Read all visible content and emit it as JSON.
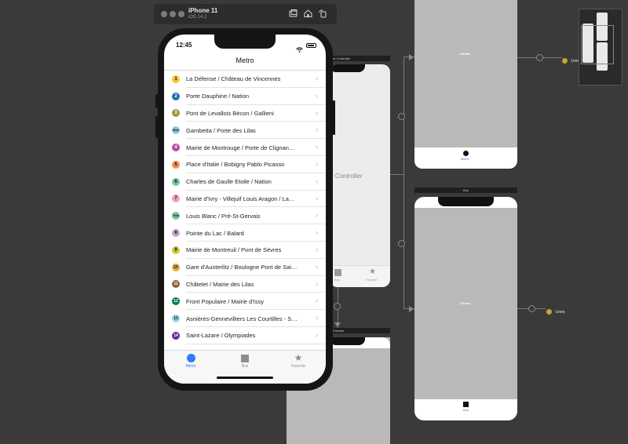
{
  "simulator": {
    "device": "iPhone 11",
    "os": "iOS 14.2",
    "icons": [
      "screenshot-icon",
      "home-icon",
      "rotate-icon"
    ]
  },
  "storyboard": {
    "controller_header": "ar Controller",
    "controller_center": "r Controller",
    "controller_tabs": [
      "Metro",
      "Bus",
      "Favorite"
    ],
    "metro_scene": {
      "uiview": "UIView",
      "tab": "Metro"
    },
    "bus_scene": {
      "title": "Bus",
      "uiview": "UIView",
      "tab": "Bus"
    },
    "favorite_scene": {
      "title": "Favorite"
    },
    "lines_label_1": "Lines",
    "lines_label_2": "Lines"
  },
  "status_bar": {
    "time": "12:45"
  },
  "nav": {
    "title": "Metro"
  },
  "lines": [
    {
      "num": "1",
      "label": "La Défense / Château de Vincennes",
      "color": "#f2c931",
      "text": "#111111"
    },
    {
      "num": "2",
      "label": "Porte Dauphine / Nation",
      "color": "#216eb4",
      "text": "#ffffff"
    },
    {
      "num": "3",
      "label": "Pont de Levallois Bécon / Gallieni",
      "color": "#9a993a",
      "text": "#ffffff"
    },
    {
      "num": "3bis",
      "label": "Gambetta / Porte des Lilas",
      "color": "#89c7d6",
      "text": "#111111"
    },
    {
      "num": "4",
      "label": "Mairie de Montrouge / Porte de Clignan…",
      "color": "#bb4b9c",
      "text": "#ffffff"
    },
    {
      "num": "5",
      "label": "Place d'Italie / Bobigny Pablo Picasso",
      "color": "#f68f4b",
      "text": "#111111"
    },
    {
      "num": "6",
      "label": "Charles de Gaulle Etoile / Nation",
      "color": "#77c696",
      "text": "#111111"
    },
    {
      "num": "7",
      "label": "Mairie d'Ivry - Villejuif Louis Aragon / La…",
      "color": "#f59fb3",
      "text": "#111111"
    },
    {
      "num": "7bis",
      "label": "Louis Blanc / Pré-St-Gervais",
      "color": "#77c696",
      "text": "#111111"
    },
    {
      "num": "8",
      "label": "Pointe du Lac / Balard",
      "color": "#c5a3cd",
      "text": "#111111"
    },
    {
      "num": "9",
      "label": "Mairie de Montreuil / Pont de Sèvres",
      "color": "#cdc83f",
      "text": "#111111"
    },
    {
      "num": "10",
      "label": "Gare d'Austerlitz / Boulogne Pont de Sai…",
      "color": "#e0b03b",
      "text": "#111111"
    },
    {
      "num": "11",
      "label": "Châtelet / Mairie des Lilas",
      "color": "#8d6538",
      "text": "#ffffff"
    },
    {
      "num": "12",
      "label": "Front Populaire / Mairie d'Issy",
      "color": "#00814f",
      "text": "#ffffff"
    },
    {
      "num": "13",
      "label": "Asnières-Gennevilliers Les Courtilles - S…",
      "color": "#98d4e2",
      "text": "#111111"
    },
    {
      "num": "14",
      "label": "Saint-Lazare / Olympiades",
      "color": "#662c91",
      "text": "#ffffff"
    }
  ],
  "tabbar": {
    "tabs": [
      {
        "label": "Metro",
        "icon": "circle-icon",
        "color": "#2f7cf6"
      },
      {
        "label": "Bus",
        "icon": "square-icon",
        "color": "#8e8e8e"
      },
      {
        "label": "Favorite",
        "icon": "star-icon",
        "color": "#8e8e8e"
      }
    ]
  }
}
